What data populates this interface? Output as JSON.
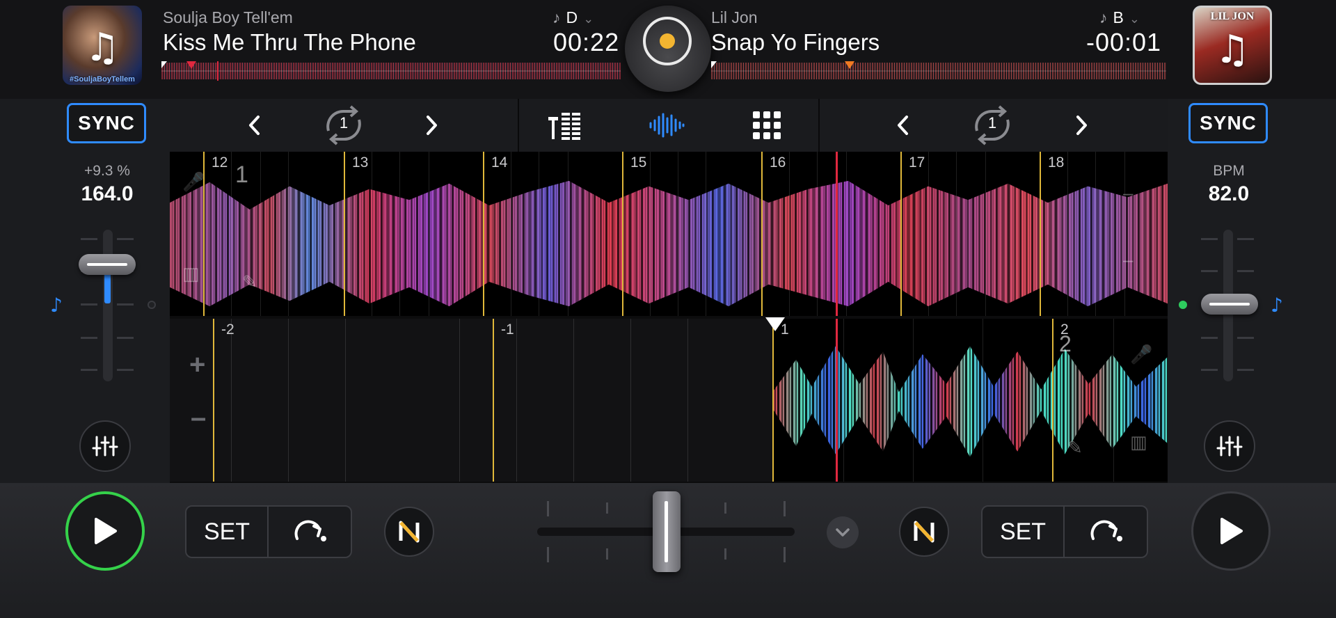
{
  "deck_a": {
    "artist": "Soulja Boy Tell'em",
    "title": "Kiss Me Thru The Phone",
    "key": "D",
    "time": "00:22",
    "art_caption": "#SouljaBoyTellem",
    "sync_label": "SYNC",
    "pitch_percent": "+9.3 %",
    "bpm": "164.0",
    "cue": {
      "set_label": "SET"
    },
    "playing": true
  },
  "deck_b": {
    "artist": "Lil Jon",
    "title": "Snap Yo Fingers",
    "key": "B",
    "time": "-00:01",
    "art_caption": "LIL JON",
    "sync_label": "SYNC",
    "bpm_label": "BPM",
    "bpm": "82.0",
    "cue": {
      "set_label": "SET"
    },
    "playing": false
  },
  "toolbar": {
    "left_loop_count": "1",
    "right_loop_count": "1"
  },
  "waveform_top": {
    "bar_numbers": [
      "12",
      "13",
      "14",
      "15",
      "16",
      "17",
      "18"
    ],
    "hotcue_label": "1"
  },
  "waveform_bottom": {
    "bar_numbers": [
      "-2",
      "-1",
      "1",
      "2"
    ],
    "hotcue_label": "2"
  },
  "colors": {
    "accent_blue": "#2f8bff",
    "play_green": "#35d24a",
    "playhead_red": "#e0283f",
    "bar_yellow": "#e0b83a",
    "knob_yellow": "#f3b531"
  },
  "icons": [
    "music-note-icon",
    "chevron-down-icon",
    "chevron-left-icon",
    "chevron-right-icon",
    "loop-icon",
    "mixer-icon",
    "waveform-icon",
    "pads-grid-icon",
    "eq-sliders-icon",
    "play-icon",
    "cue-jump-icon",
    "neural-mix-icon",
    "plus-icon",
    "minus-icon"
  ]
}
